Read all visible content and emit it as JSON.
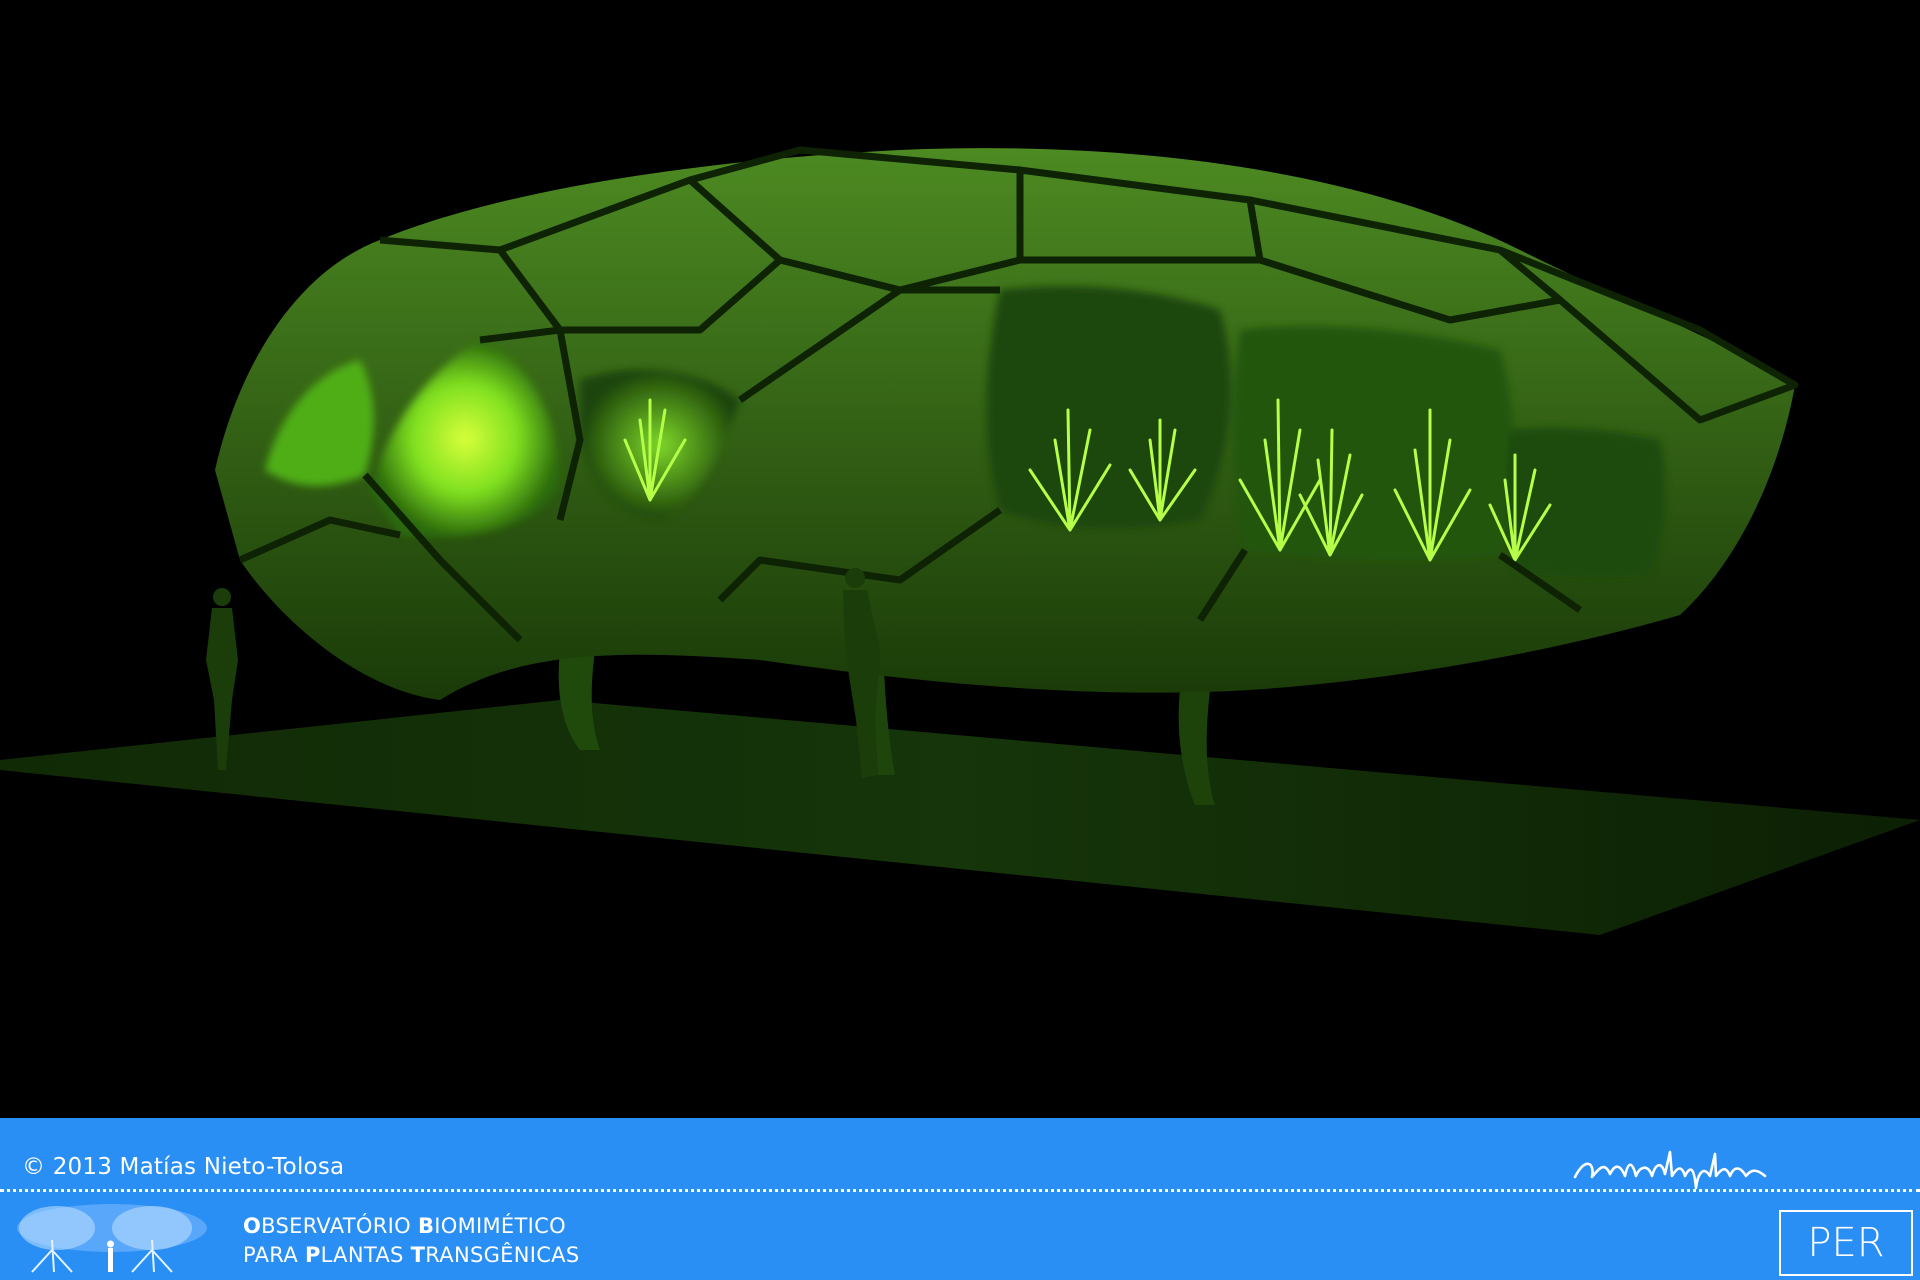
{
  "footer": {
    "copyright": "© 2013 Matías Nieto-Tolosa",
    "signature": "artemátyika",
    "title": {
      "line1": [
        {
          "initial": "O",
          "rest": "BSERVATÓRIO "
        },
        {
          "initial": "B",
          "rest": "IOMIMÉTICO"
        }
      ],
      "line2": [
        {
          "initial": "",
          "rest": "PARA "
        },
        {
          "initial": "P",
          "rest": "LANTAS "
        },
        {
          "initial": "T",
          "rest": "RANSGÊNICAS"
        }
      ]
    },
    "badge": "PER"
  },
  "colors": {
    "footer_bg": "#2a8ff5",
    "glow_green": "#9dff2a",
    "shell_green": "#2f6a10",
    "background": "#000000"
  }
}
